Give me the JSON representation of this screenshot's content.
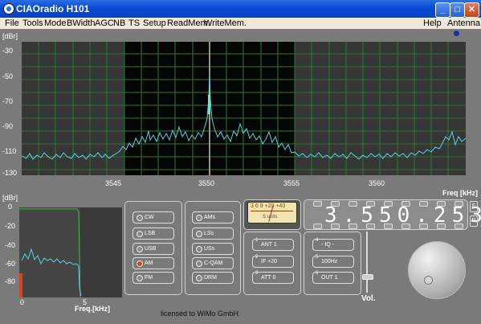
{
  "window": {
    "title": "CIAOradio H101"
  },
  "menu": {
    "items": [
      "File",
      "Tools",
      "Mode",
      "BWidth",
      "AGC",
      "NB",
      "TS",
      "Setup",
      "ReadMem.",
      "WriteMem."
    ],
    "right": [
      "Help",
      "Antenna"
    ]
  },
  "spectrum": {
    "unit": "[dBr]",
    "y_ticks": [
      "-30",
      "-50",
      "-70",
      "-90",
      "-110",
      "-130"
    ],
    "x_ticks": [
      "3545",
      "3550",
      "3555",
      "3560"
    ],
    "x_label": "Freq [kHz]"
  },
  "filter_scope": {
    "unit": "[dBr]",
    "y_ticks": [
      "0",
      "-20",
      "-40",
      "-60",
      "-80"
    ],
    "x_ticks": [
      "0",
      "5"
    ],
    "x_label": "Freq.[kHz]"
  },
  "modes": {
    "left": [
      "CW",
      "LSB",
      "USB",
      "AM",
      "FM"
    ],
    "right": [
      "AMs",
      "LSs",
      "USs",
      "C-QAM",
      "DRM"
    ],
    "selected": "AM"
  },
  "meter": {
    "scale": "3  6  9  +20 +40",
    "label": "S units"
  },
  "front_end": {
    "buttons": [
      "ANT 1",
      "IF +20",
      "ATT  0"
    ],
    "numbers": [
      "1",
      "2",
      "3"
    ]
  },
  "if_out": {
    "buttons": [
      "- IQ -",
      "100Hz",
      "OUT 1"
    ],
    "numbers": [
      "4",
      "5",
      "6"
    ]
  },
  "frequency": {
    "display": "3.550.253",
    "side_buttons": [
      "F",
      "R"
    ]
  },
  "volume": {
    "label": "Vol."
  },
  "license": {
    "text": "licensed to  WiMo GmbH"
  },
  "colors": {
    "trace": "#5ad0e6",
    "grid": "#2f7a2f",
    "accent": "#d9441a"
  }
}
